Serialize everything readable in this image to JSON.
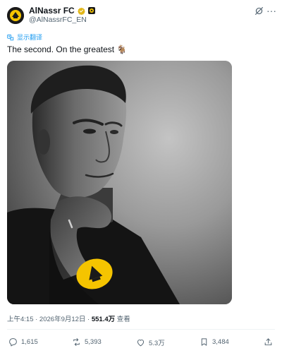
{
  "account": {
    "display_name": "AlNassr FC",
    "handle": "@AlNassrFC_EN",
    "avatar_icon": "al-nassr-logo",
    "verified_icon": "verified-badge-gold",
    "affiliation_icon": "affiliation-badge"
  },
  "header_actions": {
    "grok_icon": "grok-icon",
    "more_label": "···"
  },
  "translate": {
    "label": "显示翻译",
    "icon": "translate-icon"
  },
  "tweet": {
    "text": "The second. On the greatest 🐐"
  },
  "media": {
    "alt_icon": "photo-portrait"
  },
  "meta": {
    "time_date": "上午4:15 · 2026年9月12日 · ",
    "views_count": "551.4万",
    "views_suffix": " 查看"
  },
  "actions": {
    "reply_count": "1,615",
    "retweet_count": "5,393",
    "like_count": "5.3万",
    "bookmark_count": "3,484"
  },
  "colors": {
    "link": "#1d9bf0",
    "secondary_text": "#536471",
    "verified_gold": "#e2b719",
    "club_yellow": "#f5c400"
  }
}
